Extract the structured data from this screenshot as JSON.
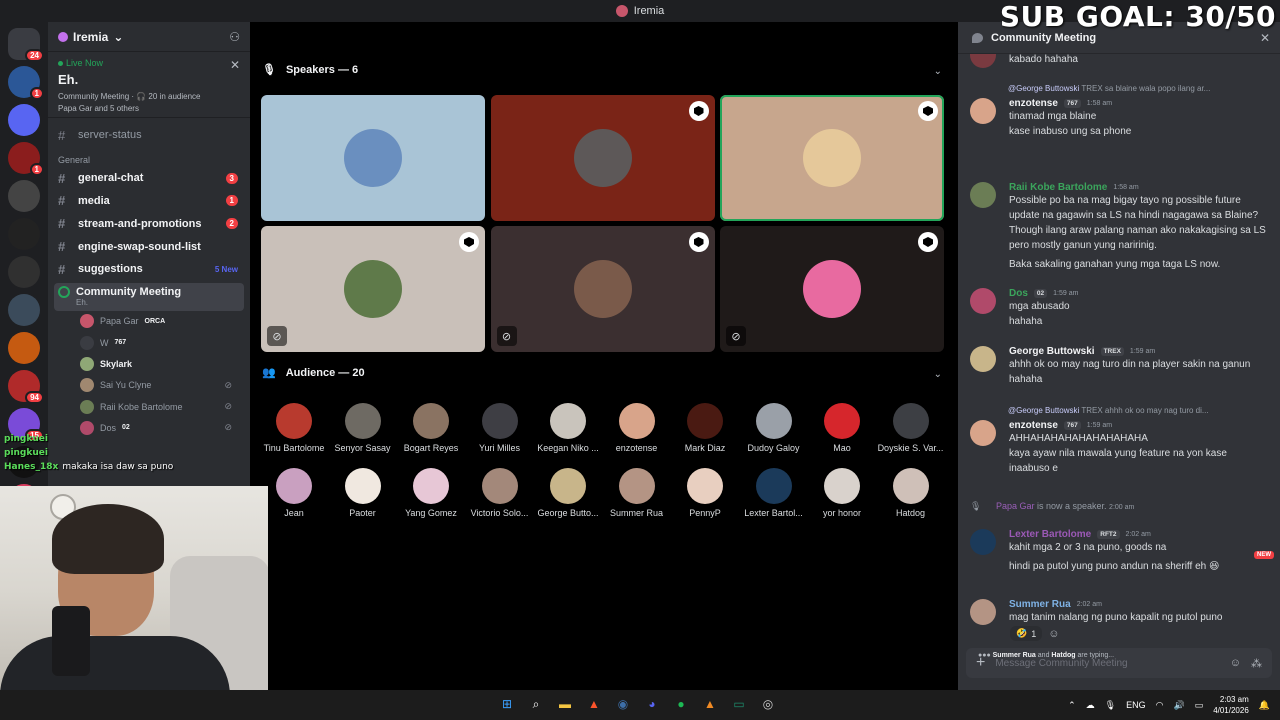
{
  "window": {
    "title": "Iremia"
  },
  "overlay": {
    "sub_goal": "SUB GOAL: 30/50"
  },
  "rail": {
    "servers": [
      {
        "color": "#3a3c42",
        "badge": "24"
      },
      {
        "color": "#2b5797",
        "badge": "1"
      },
      {
        "color": "#5865f2",
        "badge": ""
      },
      {
        "color": "#8b1d1d",
        "badge": "1"
      },
      {
        "color": "#444",
        "badge": ""
      },
      {
        "color": "#222",
        "badge": ""
      },
      {
        "color": "#303030",
        "badge": ""
      },
      {
        "color": "#3b4b5b",
        "badge": ""
      },
      {
        "color": "#c55a11",
        "badge": ""
      },
      {
        "color": "#b02a2a",
        "badge": "94"
      },
      {
        "color": "#7a4bd8",
        "badge": "15"
      },
      {
        "color": "#111",
        "badge": ""
      },
      {
        "color": "#d83c5e",
        "badge": ""
      }
    ]
  },
  "sidebar": {
    "server_name": "Iremia",
    "live": {
      "status": "Live Now",
      "title": "Eh.",
      "meta": "Community Meeting · 🎧 20 in audience",
      "speakers": "Papa Gar and 5 others"
    },
    "channels_top": [
      {
        "name": "server-status",
        "unread": false,
        "count": ""
      }
    ],
    "category": "General",
    "channels": [
      {
        "name": "general-chat",
        "unread": true,
        "count": "3",
        "new": ""
      },
      {
        "name": "media",
        "unread": true,
        "count": "1",
        "new": ""
      },
      {
        "name": "stream-and-promotions",
        "unread": true,
        "count": "2",
        "new": ""
      },
      {
        "name": "engine-swap-sound-list",
        "unread": true,
        "count": "",
        "new": ""
      },
      {
        "name": "suggestions",
        "unread": true,
        "count": "",
        "new": "5 New"
      }
    ],
    "stage": {
      "name": "Community Meeting",
      "sub": "Eh."
    },
    "voice_members": [
      {
        "name": "Papa Gar",
        "tag": "ORCA",
        "color": "#c7566b",
        "muted": false,
        "bright": false
      },
      {
        "name": "W",
        "tag": "767",
        "color": "#3a3c42",
        "muted": false,
        "bright": false
      },
      {
        "name": "Skylark",
        "tag": "",
        "color": "#8fa876",
        "muted": false,
        "bright": true
      },
      {
        "name": "Sai Yu Clyne",
        "tag": "",
        "color": "#a08870",
        "muted": true,
        "bright": false
      },
      {
        "name": "Raii Kobe Bartolome",
        "tag": "",
        "color": "#6b7d55",
        "muted": true,
        "bright": false
      },
      {
        "name": "Dos",
        "tag": "02",
        "color": "#b04a6a",
        "muted": true,
        "bright": false
      }
    ]
  },
  "stage": {
    "speakers_label": "Speakers — 6",
    "speakers": [
      {
        "bg": "#a9c4d6",
        "pic": "#6a8fbf",
        "mod": false,
        "mic_off": false,
        "active": false
      },
      {
        "bg": "#7a2417",
        "pic": "#5d5858",
        "mod": true,
        "mic_off": false,
        "active": false
      },
      {
        "bg": "#c7a68d",
        "pic": "#e5c89a",
        "mod": true,
        "mic_off": false,
        "active": true
      },
      {
        "bg": "#c9c0b9",
        "pic": "#5f7a4a",
        "mod": true,
        "mic_off": true,
        "active": false
      },
      {
        "bg": "#3b2f30",
        "pic": "#7a5a4a",
        "mod": true,
        "mic_off": true,
        "active": false
      },
      {
        "bg": "#1f1a19",
        "pic": "#e86aa0",
        "mod": true,
        "mic_off": true,
        "active": false
      }
    ],
    "audience_label": "Audience — 20",
    "audience": [
      {
        "name": "Tinu Bartolome",
        "color": "#b83a2e"
      },
      {
        "name": "Senyor Sasay",
        "color": "#6e6a63"
      },
      {
        "name": "Bogart Reyes",
        "color": "#8a7362"
      },
      {
        "name": "Yuri Milles",
        "color": "#3e3e44"
      },
      {
        "name": "Keegan Niko ...",
        "color": "#c9c4bc"
      },
      {
        "name": "enzotense",
        "color": "#d8a48a"
      },
      {
        "name": "Mark Diaz",
        "color": "#4a1a12"
      },
      {
        "name": "Dudoy Galoy",
        "color": "#9aa0a8"
      },
      {
        "name": "Mao",
        "color": "#d6262c"
      },
      {
        "name": "Doyskie S. Var...",
        "color": "#3d3f44"
      },
      {
        "name": "Jean",
        "color": "#c9a0c0"
      },
      {
        "name": "Paoter",
        "color": "#f0e8e0"
      },
      {
        "name": "Yang Gomez",
        "color": "#e7c7d6"
      },
      {
        "name": "Victorio Solo...",
        "color": "#a3887a"
      },
      {
        "name": "George Butto...",
        "color": "#c8b58a"
      },
      {
        "name": "Summer Rua",
        "color": "#b49484"
      },
      {
        "name": "PennyP",
        "color": "#e8cfc0"
      },
      {
        "name": "Lexter Bartol...",
        "color": "#1b3a5a"
      },
      {
        "name": "yor honor",
        "color": "#d9d2cc"
      },
      {
        "name": "Hatdog",
        "color": "#cfc0b8"
      }
    ]
  },
  "chat": {
    "title": "Community Meeting",
    "messages": [
      {
        "kind": "cont",
        "text": "kabado hahaha"
      },
      {
        "kind": "reply",
        "reply_to": "@George Buttowski",
        "reply_tag": "TREX",
        "reply_text": "sa blaine wala popo ilang ar...",
        "author": "enzotense",
        "author_color": "#f2f3f5",
        "tag": "767",
        "time": "1:58 am",
        "lines": [
          "tinamad mga blaine",
          "kase inabuso ung sa phone"
        ],
        "avatar": "#d8a48a"
      },
      {
        "kind": "msg",
        "author": "Raii Kobe Bartolome",
        "author_color": "#3ba55c",
        "tag": "",
        "time": "1:58 am",
        "lines": [
          "Possible po ba na mag bigay tayo ng possible future update na gagawin sa LS na hindi nagagawa sa Blaine? Though ilang araw palang naman ako nakakagising sa LS pero mostly ganun yung naririnig.",
          "Baka sakaling ganahan yung mga taga LS now."
        ],
        "avatar": "#6b7d55"
      },
      {
        "kind": "msg",
        "author": "Dos",
        "author_color": "#3ba55c",
        "tag": "02",
        "time": "1:59 am",
        "lines": [
          "mga abusado",
          "hahaha"
        ],
        "avatar": "#b04a6a"
      },
      {
        "kind": "msg",
        "author": "George Buttowski",
        "author_color": "#f2f3f5",
        "tag": "TREX",
        "time": "1:59 am",
        "lines": [
          "ahhh ok oo may nag turo din na player sakin na ganun hahaha"
        ],
        "avatar": "#c8b58a"
      },
      {
        "kind": "reply",
        "reply_to": "@George Buttowski",
        "reply_tag": "TREX",
        "reply_text": "ahhh ok oo may nag turo di...",
        "author": "enzotense",
        "author_color": "#f2f3f5",
        "tag": "767",
        "time": "1:59 am",
        "lines": [
          "AHHAHAHAHAHAHAHAHAHA",
          "kaya ayaw nila mawala yung feature na yon kase inaabuso e"
        ],
        "avatar": "#d8a48a"
      },
      {
        "kind": "system",
        "who": "Papa Gar",
        "text": "is now a speaker.",
        "time": "2:00 am"
      },
      {
        "kind": "msg",
        "author": "Lexter Bartolome",
        "author_color": "#9b59b6",
        "tag": "RFT2",
        "time": "2:02 am",
        "lines": [
          "kahit mga 2 or 3 na puno, goods na",
          "hindi pa putol yung puno andun na sheriff eh 😆"
        ],
        "avatar": "#1b3a5a",
        "new_label": "NEW"
      },
      {
        "kind": "msg",
        "author": "Summer Rua",
        "author_color": "#7fb2e5",
        "tag": "",
        "time": "2:02 am",
        "lines": [
          "mag tanim nalang ng puno kapalit ng putol puno"
        ],
        "avatar": "#b49484"
      }
    ],
    "reaction": {
      "emoji": "🤣",
      "count": "1"
    },
    "typing": {
      "who1": "Summer Rua",
      "and": "and",
      "who2": "Hatdog",
      "suffix": "are typing..."
    },
    "composer_placeholder": "Message Community Meeting"
  },
  "stream_chat": [
    {
      "user": "pingkuei",
      "text": ""
    },
    {
      "user": "pingkuei",
      "text": ""
    },
    {
      "user": "Hanes_18x",
      "text": "makaka isa daw sa puno"
    }
  ],
  "taskbar": {
    "apps": [
      {
        "icon": "windows-icon",
        "glyph": "⊞",
        "color": "#3aa0ff"
      },
      {
        "icon": "search-icon",
        "glyph": "⌕",
        "color": "#ffffff"
      },
      {
        "icon": "folder-icon",
        "glyph": "▬",
        "color": "#f4c542"
      },
      {
        "icon": "brave-icon",
        "glyph": "▲",
        "color": "#fb542b"
      },
      {
        "icon": "steam-icon",
        "glyph": "◉",
        "color": "#3d6ea8"
      },
      {
        "icon": "discord-icon",
        "glyph": "◕",
        "color": "#5865f2"
      },
      {
        "icon": "spotify-icon",
        "glyph": "●",
        "color": "#1db954"
      },
      {
        "icon": "app-icon",
        "glyph": "▲",
        "color": "#f08a24"
      },
      {
        "icon": "terminal-icon",
        "glyph": "▭",
        "color": "#1c8c6c"
      },
      {
        "icon": "obs-icon",
        "glyph": "◎",
        "color": "#cfcfcf"
      }
    ],
    "tray": {
      "lang": "ENG",
      "time": "2:03 am",
      "date": "4/01/2026"
    }
  }
}
